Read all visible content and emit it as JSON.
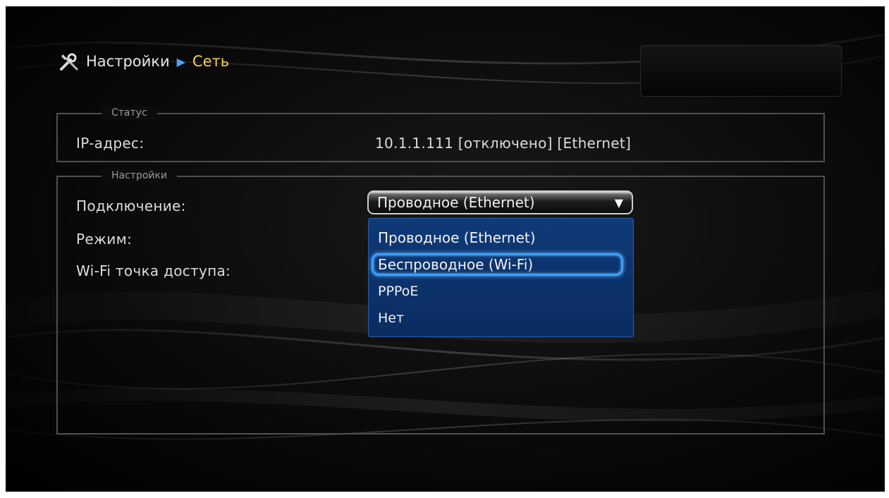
{
  "breadcrumb": {
    "root": "Настройки",
    "current": "Сеть"
  },
  "status_group": {
    "legend": "Статус",
    "ip_label": "IP-адрес:",
    "ip_value": "10.1.1.111 [отключено] [Ethernet]"
  },
  "settings_group": {
    "legend": "Настройки",
    "connection_label": "Подключение:",
    "mode_label": "Режим:",
    "wifi_label": "Wi-Fi точка доступа:"
  },
  "connection_select": {
    "selected": "Проводное (Ethernet)",
    "options": [
      "Проводное (Ethernet)",
      "Беспроводное (Wi-Fi)",
      "PPPoE",
      "Нет"
    ],
    "highlighted_index": 1
  },
  "colors": {
    "accent_current": "#f4d24a",
    "separator": "#4aa3ff",
    "dropdown_bg": "#0f3a78",
    "focus_ring": "#3aa0ff"
  },
  "icons": {
    "settings": "tools-icon",
    "separator": "play-arrow-icon",
    "dropdown": "triangle-down-icon"
  }
}
